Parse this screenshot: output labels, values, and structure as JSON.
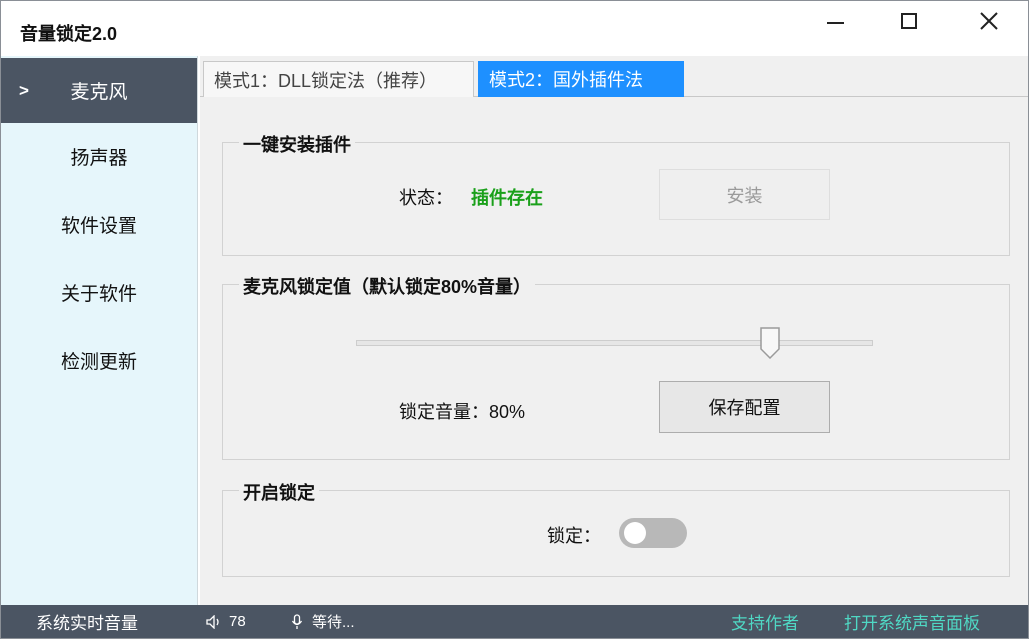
{
  "window": {
    "title": "音量锁定2.0"
  },
  "sidebar": {
    "items": [
      {
        "label": "麦克风",
        "active": true,
        "marker": ">"
      },
      {
        "label": "扬声器"
      },
      {
        "label": "软件设置"
      },
      {
        "label": "关于软件"
      },
      {
        "label": "检测更新"
      }
    ]
  },
  "tabs": [
    {
      "label": "模式1：DLL锁定法（推荐）",
      "active": false
    },
    {
      "label": "模式2：国外插件法",
      "active": true
    }
  ],
  "install_group": {
    "title": "一键安装插件",
    "status_label": "状态：",
    "status_value": "插件存在",
    "status_color": "#1aa01a",
    "install_button": "安装",
    "install_enabled": false
  },
  "lock_value_group": {
    "title": "麦克风锁定值（默认锁定80%音量）",
    "slider_value": 80,
    "volume_label": "锁定音量：80%",
    "save_button": "保存配置"
  },
  "enable_group": {
    "title": "开启锁定",
    "lock_label": "锁定：",
    "lock_on": false
  },
  "statusbar": {
    "realtime_label": "系统实时音量",
    "speaker_icon": "speaker-icon",
    "speaker_value": "78",
    "mic_icon": "microphone-icon",
    "mic_status": "等待...",
    "support_link": "支持作者",
    "open_panel_link": "打开系统声音面板",
    "accent": "#4fd8c4",
    "background": "#4b5563"
  }
}
